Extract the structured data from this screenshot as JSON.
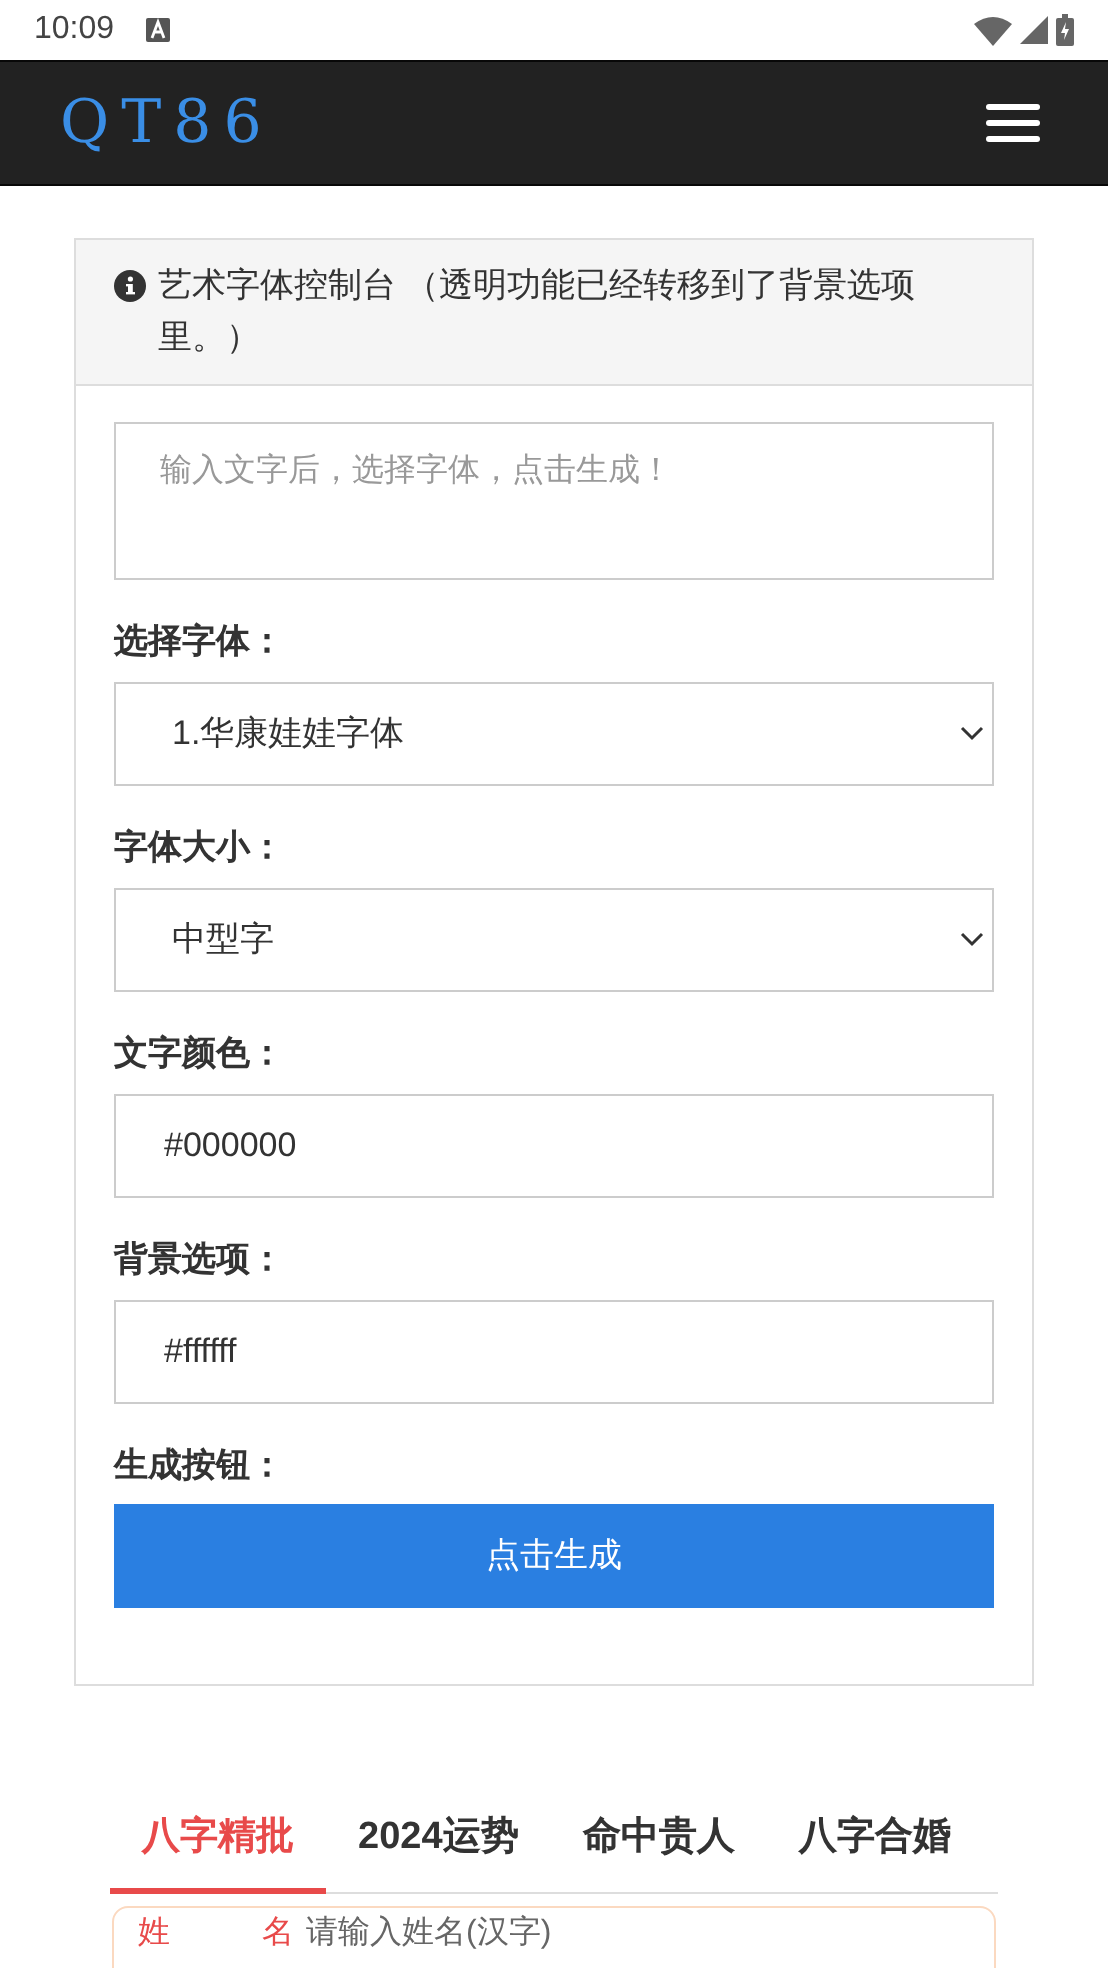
{
  "status_bar": {
    "time": "10:09"
  },
  "navbar": {
    "logo": "QT86"
  },
  "panel": {
    "title": "艺术字体控制台 （透明功能已经转移到了背景选项里。）",
    "textarea": {
      "placeholder": "输入文字后，选择字体，点击生成！"
    },
    "fields": [
      {
        "kind": "select",
        "label": "选择字体：",
        "value": "1.华康娃娃字体"
      },
      {
        "kind": "select",
        "label": "字体大小：",
        "value": "中型字"
      },
      {
        "kind": "input",
        "label": "文字颜色：",
        "value": "#000000"
      },
      {
        "kind": "input",
        "label": "背景选项：",
        "value": "#ffffff"
      }
    ],
    "button_label": "生成按钮：",
    "button": "点击生成"
  },
  "tabs": [
    {
      "label": "八字精批",
      "selected": true
    },
    {
      "label": "2024运势",
      "selected": false
    },
    {
      "label": "命中贵人",
      "selected": false
    },
    {
      "label": "八字合婚",
      "selected": false
    }
  ],
  "form": {
    "name_label_1": "姓",
    "name_label_2": "名",
    "name_placeholder": "请输入姓名(汉字)"
  }
}
